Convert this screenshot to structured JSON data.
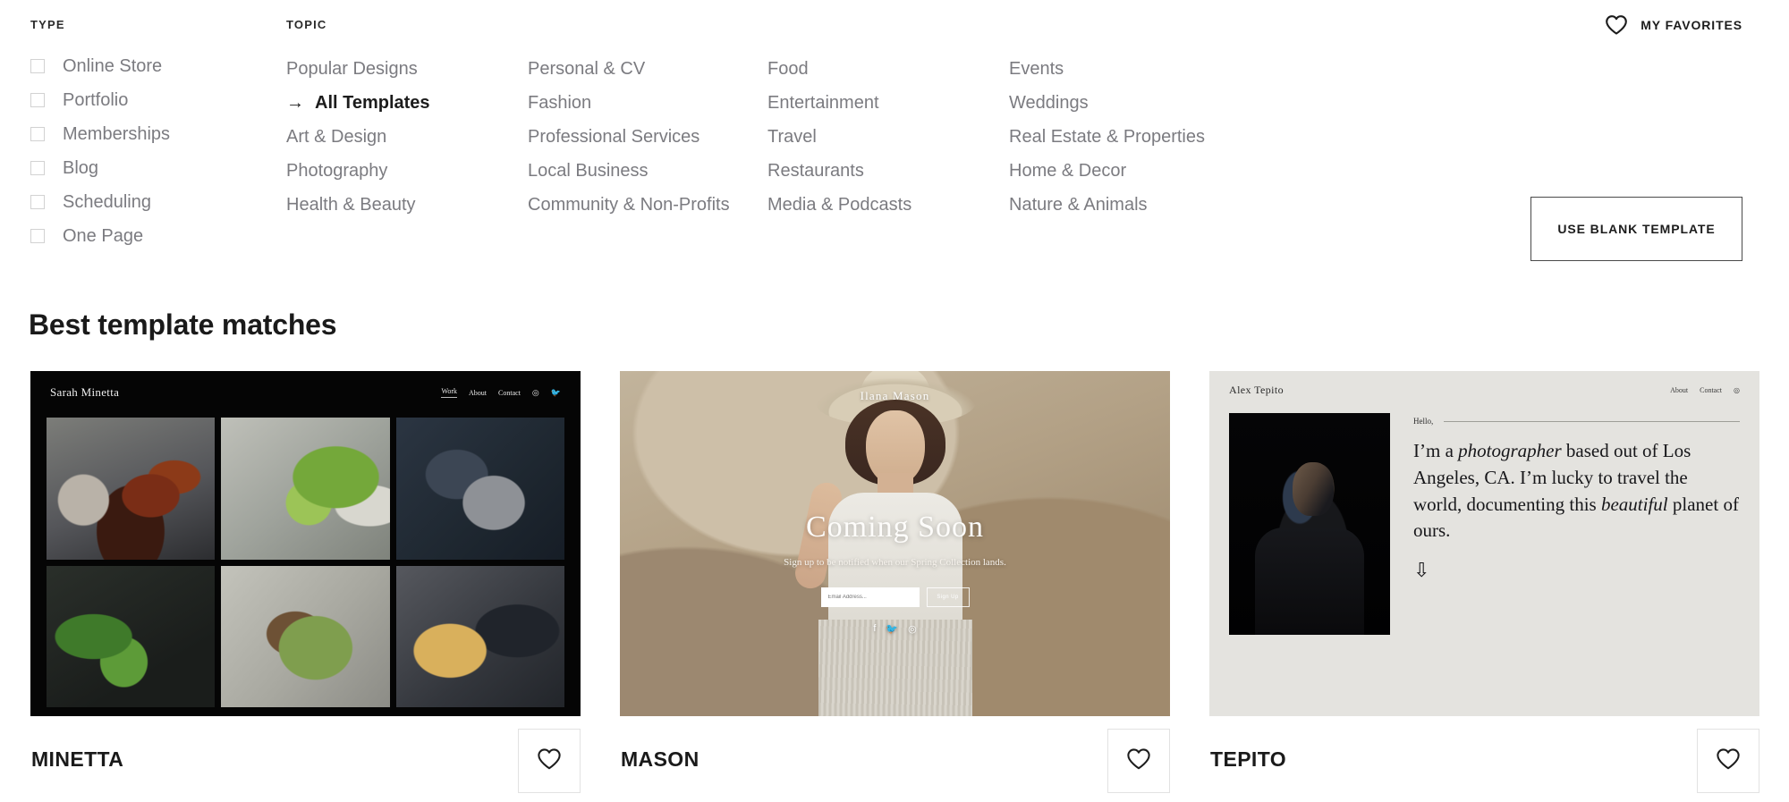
{
  "filters": {
    "type_header": "TYPE",
    "topic_header": "TOPIC",
    "type_items": [
      {
        "label": "Online Store"
      },
      {
        "label": "Portfolio"
      },
      {
        "label": "Memberships"
      },
      {
        "label": "Blog"
      },
      {
        "label": "Scheduling"
      },
      {
        "label": "One Page"
      }
    ],
    "topic_columns": [
      [
        {
          "label": "Popular Designs",
          "active": false
        },
        {
          "label": "All Templates",
          "active": true
        },
        {
          "label": "Art & Design",
          "active": false
        },
        {
          "label": "Photography",
          "active": false
        },
        {
          "label": "Health & Beauty",
          "active": false
        }
      ],
      [
        {
          "label": "Personal & CV",
          "active": false
        },
        {
          "label": "Fashion",
          "active": false
        },
        {
          "label": "Professional Services",
          "active": false
        },
        {
          "label": "Local Business",
          "active": false
        },
        {
          "label": "Community & Non-Profits",
          "active": false
        }
      ],
      [
        {
          "label": "Food",
          "active": false
        },
        {
          "label": "Entertainment",
          "active": false
        },
        {
          "label": "Travel",
          "active": false
        },
        {
          "label": "Restaurants",
          "active": false
        },
        {
          "label": "Media & Podcasts",
          "active": false
        }
      ],
      [
        {
          "label": "Events",
          "active": false
        },
        {
          "label": "Weddings",
          "active": false
        },
        {
          "label": "Real Estate & Properties",
          "active": false
        },
        {
          "label": "Home & Decor",
          "active": false
        },
        {
          "label": "Nature & Animals",
          "active": false
        }
      ]
    ],
    "active_arrow_glyph": "→"
  },
  "header": {
    "favorites_label": "MY FAVORITES",
    "favorites_icon": "heart-outline-icon",
    "blank_template_label": "USE BLANK TEMPLATE"
  },
  "section": {
    "title": "Best template matches"
  },
  "cards": [
    {
      "name": "MINETTA",
      "favorite_icon": "heart-outline-icon",
      "preview": {
        "brand": "Sarah Minetta",
        "nav": [
          "Work",
          "About",
          "Contact"
        ],
        "social": [
          "◎",
          "🐦"
        ]
      }
    },
    {
      "name": "MASON",
      "favorite_icon": "heart-outline-icon",
      "preview": {
        "brand": "Ilana Mason",
        "heading": "Coming Soon",
        "subtext": "Sign up to be notified when our Spring Collection lands.",
        "input_placeholder": "Email Address...",
        "submit_label": "Sign Up",
        "social": [
          "f",
          "🐦",
          "◎"
        ]
      }
    },
    {
      "name": "TEPITO",
      "favorite_icon": "heart-outline-icon",
      "preview": {
        "brand": "Alex Tepito",
        "nav": [
          "About",
          "Contact"
        ],
        "social": "◎",
        "hello": "Hello,",
        "paragraph_parts": [
          {
            "text": "I’m a ",
            "italic": false
          },
          {
            "text": "photographer",
            "italic": true
          },
          {
            "text": " based out of Los Angeles, CA. I’m lucky to travel the world, documenting this ",
            "italic": false
          },
          {
            "text": "beautiful",
            "italic": true
          },
          {
            "text": " planet of ours.",
            "italic": false
          }
        ],
        "arrow_glyph": "⇩"
      }
    }
  ],
  "colors": {
    "page_background": "#ffffff",
    "muted_text": "#7b7b80",
    "primary_text": "#1a1a1a",
    "checkbox_border": "#d2d2d2",
    "button_border": "#4a4a4a",
    "tepito_background": "#e4e3df",
    "minetta_background": "#050505"
  }
}
